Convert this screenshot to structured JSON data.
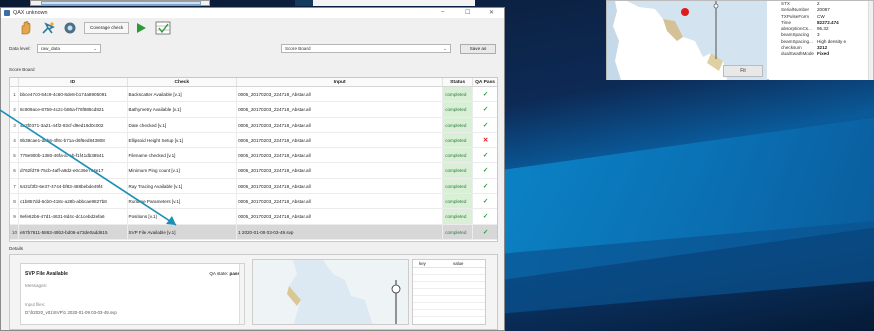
{
  "window": {
    "title": "QAX unknown",
    "controls": [
      "–",
      "☐",
      "✕"
    ]
  },
  "toolbar": {
    "icons": [
      "hand-icon",
      "pointer-icon",
      "tool-icon"
    ],
    "coverage_check_label": "Coverage check",
    "play_icon": "play-icon",
    "table_icon": "table-icon"
  },
  "controls": {
    "data_level_label": "Data level:",
    "data_level_value": "raw_data",
    "board_select_value": "Score Board",
    "save_as_label": "Save as"
  },
  "score_board": {
    "label": "Score Board",
    "columns": [
      "",
      "ID",
      "Check",
      "Input",
      "Status",
      "QA Pass"
    ],
    "rows": [
      {
        "n": "1",
        "id": "bbce47c0-54c9-4c60-8de8-b174a8905091",
        "check": "Backscatter Available [v.1]",
        "input": "0005_20170203_224718_Abstar.all",
        "status": "completed",
        "qa": "✓",
        "pass": true
      },
      {
        "n": "2",
        "id": "8c909ace-8759-4c2c-b86a-f76f888cd821",
        "check": "Bathymetry Available [v.1]",
        "input": "0005_20170203_224718_Abstar.all",
        "status": "completed",
        "qa": "✓",
        "pass": true
      },
      {
        "n": "3",
        "id": "4a3f0371-3a21-44f2-93cf-d9ed19d0c002",
        "check": "Date checked [v.1]",
        "input": "0005_20170203_224718_Abstar.all",
        "status": "completed",
        "qa": "✓",
        "pass": true
      },
      {
        "n": "4",
        "id": "9b39cae1-dbb6-4f8c-b71a-d6f6ed843808",
        "check": "Ellipsoid Height Setup [v.1]",
        "input": "0005_20170203_224718_Abstar.all",
        "status": "completed",
        "qa": "✕",
        "pass": false
      },
      {
        "n": "5",
        "id": "778e900b-1380-46fa-a7eb-f1f41db38541",
        "check": "Filename checked [v.1]",
        "input": "0005_20170203_224718_Abstar.all",
        "status": "completed",
        "qa": "✓",
        "pass": true
      },
      {
        "n": "6",
        "id": "d762fd79-75cb-4aff-a9d2-e0c36e744e17",
        "check": "Minimum Ping count [v.1]",
        "input": "0005_20170203_224718_Abstar.all",
        "status": "completed",
        "qa": "✓",
        "pass": true
      },
      {
        "n": "7",
        "id": "5421f3f2-6e37-4744-bf83-488bebde49f4",
        "check": "Ray Tracing Available [v.1]",
        "input": "0005_20170203_224718_Abstar.all",
        "status": "completed",
        "qa": "✓",
        "pass": true
      },
      {
        "n": "8",
        "id": "c1b857dd-6cb0-418c-a28b-abbcae9827b8",
        "check": "Runtime Parameters [v.1]",
        "input": "0005_20170203_224718_Abstar.all",
        "status": "completed",
        "qa": "✓",
        "pass": true
      },
      {
        "n": "9",
        "id": "9efe62b6-47d1-4631-8d4c-dc1cebd2efa6",
        "check": "Positions [v.1]",
        "input": "0005_20170203_224718_Abstar.all",
        "status": "completed",
        "qa": "✓",
        "pass": true
      },
      {
        "n": "10",
        "id": "e57b7611-5863-49b3-bd06-a73de0add615",
        "check": "SVP File Available [v.1]",
        "input": "1  2020-01-09  03-03-49.svp",
        "status": "completed",
        "qa": "✓",
        "pass": true
      }
    ]
  },
  "details": {
    "label": "Details",
    "title": "SVP File Available",
    "qa_state_label": "QA state:",
    "qa_state_value": "pass",
    "messages_label": "Messages:",
    "input_files_label": "Input files:",
    "input_file_path": "D:\\fr2020_v01\\SVP\\1  2020-01-09  03-03-49.svp",
    "kv_headers": [
      "key",
      "value"
    ]
  },
  "side_panel": {
    "fit_label": "Fit",
    "properties": [
      {
        "k": "STX",
        "v": "2",
        "bold": false
      },
      {
        "k": "SerialNumber",
        "v": "20087",
        "bold": false
      },
      {
        "k": "TXPulseForm",
        "v": "CW",
        "bold": false
      },
      {
        "k": "Time",
        "v": "82272.474",
        "bold": true
      },
      {
        "k": "absorptionCs...",
        "v": "95.32",
        "bold": false
      },
      {
        "k": "beamSpacing",
        "v": "3",
        "bold": false
      },
      {
        "k": "beamSpacing...",
        "v": "High density e",
        "bold": false
      },
      {
        "k": "checksum",
        "v": "3212",
        "bold": true
      },
      {
        "k": "dualSwathMode",
        "v": "Fixed",
        "bold": true
      }
    ]
  },
  "colors": {
    "accent_green": "#2f9a3c",
    "fail_red": "#d81e1e",
    "status_bg": "#d9efd6",
    "arrow": "#1b8fb5"
  }
}
